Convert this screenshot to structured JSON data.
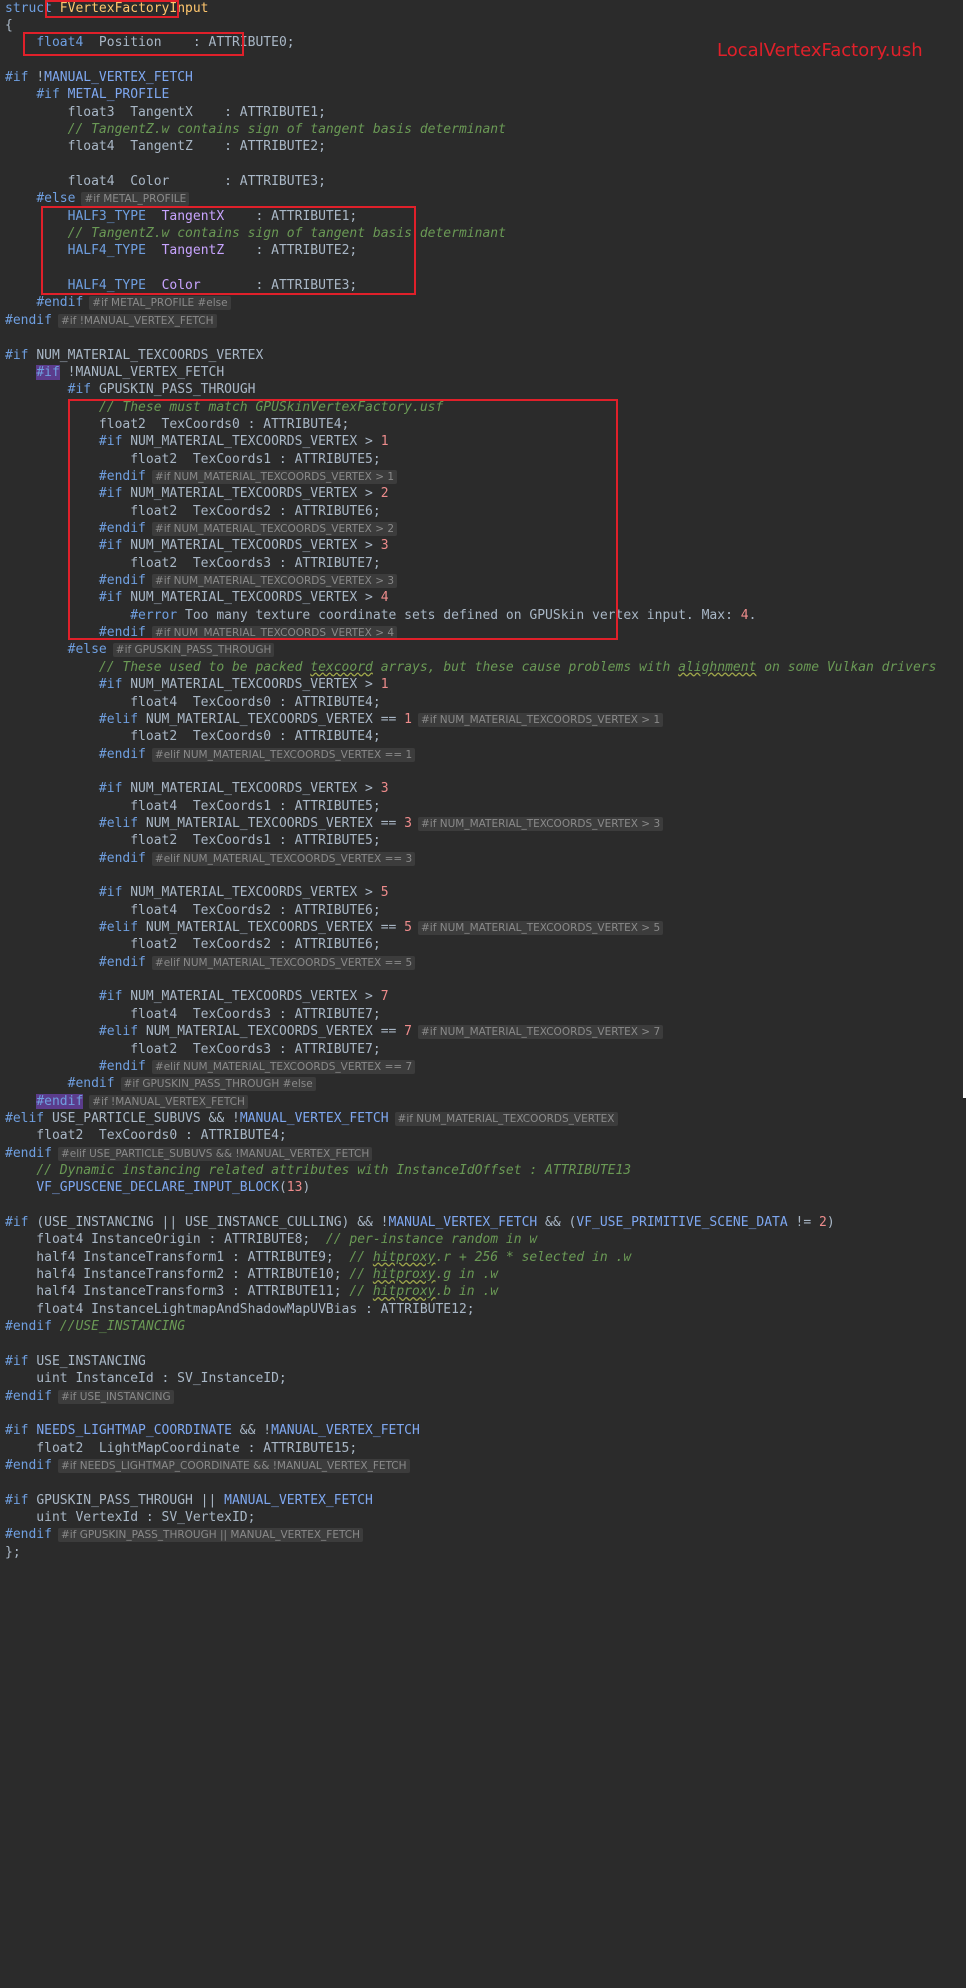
{
  "annotation": "LocalVertexFactory.ush",
  "lines": [
    [
      [
        "k",
        "struct "
      ],
      [
        "sel",
        "FVertexFactoryInput"
      ]
    ],
    [
      [
        "p",
        "{"
      ]
    ],
    [
      [
        "p",
        "    "
      ],
      [
        "k",
        "float4"
      ],
      [
        "p",
        "  Position    : ATTRIBUTE0;"
      ]
    ],
    [],
    [
      [
        "dir",
        "#if "
      ],
      [
        "p",
        "!"
      ],
      [
        "m",
        "MANUAL_VERTEX_FETCH"
      ]
    ],
    [
      [
        "p",
        "    "
      ],
      [
        "dir",
        "#if "
      ],
      [
        "m",
        "METAL_PROFILE"
      ]
    ],
    [
      [
        "p",
        "        float3  TangentX    : ATTRIBUTE1;"
      ]
    ],
    [
      [
        "p",
        "        "
      ],
      [
        "c",
        "// TangentZ.w contains sign of tangent basis determinant"
      ]
    ],
    [
      [
        "p",
        "        float4  TangentZ    : ATTRIBUTE2;"
      ]
    ],
    [],
    [
      [
        "p",
        "        float4  Color       : ATTRIBUTE3;"
      ]
    ],
    [
      [
        "p",
        "    "
      ],
      [
        "dir",
        "#else"
      ],
      [
        "h",
        "#if METAL_PROFILE"
      ]
    ],
    [
      [
        "p",
        "        "
      ],
      [
        "k",
        "HALF3_TYPE"
      ],
      [
        "p",
        "  "
      ],
      [
        "t",
        "TangentX"
      ],
      [
        "p",
        "    : ATTRIBUTE1;"
      ]
    ],
    [
      [
        "p",
        "        "
      ],
      [
        "c",
        "// TangentZ.w contains sign of tangent basis determinant"
      ]
    ],
    [
      [
        "p",
        "        "
      ],
      [
        "k",
        "HALF4_TYPE"
      ],
      [
        "p",
        "  "
      ],
      [
        "t",
        "TangentZ"
      ],
      [
        "p",
        "    : ATTRIBUTE2;"
      ]
    ],
    [],
    [
      [
        "p",
        "        "
      ],
      [
        "k",
        "HALF4_TYPE"
      ],
      [
        "p",
        "  "
      ],
      [
        "t",
        "Color"
      ],
      [
        "p",
        "       : ATTRIBUTE3;"
      ]
    ],
    [
      [
        "p",
        "    "
      ],
      [
        "dir",
        "#endif"
      ],
      [
        "h",
        "#if METAL_PROFILE #else"
      ]
    ],
    [
      [
        "dir",
        "#endif"
      ],
      [
        "h",
        "#if !MANUAL_VERTEX_FETCH"
      ]
    ],
    [],
    [
      [
        "dir",
        "#if "
      ],
      [
        "p",
        "NUM_MATERIAL_TEXCOORDS_VERTEX"
      ]
    ],
    [
      [
        "p",
        "    "
      ],
      [
        "hl",
        "#if"
      ],
      [
        "p",
        " !MANUAL_VERTEX_FETCH"
      ]
    ],
    [
      [
        "p",
        "        "
      ],
      [
        "dir",
        "#if "
      ],
      [
        "p",
        "GPUSKIN_PASS_THROUGH"
      ]
    ],
    [
      [
        "p",
        "            "
      ],
      [
        "c",
        "// These must match GPUSkinVertexFactory.usf"
      ]
    ],
    [
      [
        "p",
        "            float2  TexCoords0 : ATTRIBUTE4;"
      ]
    ],
    [
      [
        "p",
        "            "
      ],
      [
        "dir",
        "#if "
      ],
      [
        "p",
        "NUM_MATERIAL_TEXCOORDS_VERTEX > "
      ],
      [
        "n",
        "1"
      ]
    ],
    [
      [
        "p",
        "                float2  TexCoords1 : ATTRIBUTE5;"
      ]
    ],
    [
      [
        "p",
        "            "
      ],
      [
        "dir",
        "#endif"
      ],
      [
        "h",
        "#if NUM_MATERIAL_TEXCOORDS_VERTEX > 1"
      ]
    ],
    [
      [
        "p",
        "            "
      ],
      [
        "dir",
        "#if "
      ],
      [
        "p",
        "NUM_MATERIAL_TEXCOORDS_VERTEX > "
      ],
      [
        "n",
        "2"
      ]
    ],
    [
      [
        "p",
        "                float2  TexCoords2 : ATTRIBUTE6;"
      ]
    ],
    [
      [
        "p",
        "            "
      ],
      [
        "dir",
        "#endif"
      ],
      [
        "h",
        "#if NUM_MATERIAL_TEXCOORDS_VERTEX > 2"
      ]
    ],
    [
      [
        "p",
        "            "
      ],
      [
        "dir",
        "#if "
      ],
      [
        "p",
        "NUM_MATERIAL_TEXCOORDS_VERTEX > "
      ],
      [
        "n",
        "3"
      ]
    ],
    [
      [
        "p",
        "                float2  TexCoords3 : ATTRIBUTE7;"
      ]
    ],
    [
      [
        "p",
        "            "
      ],
      [
        "dir",
        "#endif"
      ],
      [
        "h",
        "#if NUM_MATERIAL_TEXCOORDS_VERTEX > 3"
      ]
    ],
    [
      [
        "p",
        "            "
      ],
      [
        "dir",
        "#if "
      ],
      [
        "p",
        "NUM_MATERIAL_TEXCOORDS_VERTEX > "
      ],
      [
        "n",
        "4"
      ]
    ],
    [
      [
        "p",
        "                "
      ],
      [
        "dir",
        "#error"
      ],
      [
        "p",
        " Too many texture coordinate sets defined on GPUSkin vertex input. Max: "
      ],
      [
        "n",
        "4"
      ],
      [
        "p",
        "."
      ]
    ],
    [
      [
        "p",
        "            "
      ],
      [
        "dir",
        "#endif"
      ],
      [
        "h",
        "#if NUM_MATERIAL_TEXCOORDS_VERTEX > 4"
      ]
    ],
    [
      [
        "p",
        "        "
      ],
      [
        "dir",
        "#else"
      ],
      [
        "h",
        "#if GPUSKIN_PASS_THROUGH"
      ]
    ],
    [
      [
        "p",
        "            "
      ],
      [
        "c",
        "// These used to be packed "
      ],
      [
        "cu",
        "texcoord"
      ],
      [
        "c",
        " arrays, but these cause problems with "
      ],
      [
        "cu",
        "alighnment"
      ],
      [
        "c",
        " on some Vulkan drivers"
      ]
    ],
    [
      [
        "p",
        "            "
      ],
      [
        "dir",
        "#if "
      ],
      [
        "p",
        "NUM_MATERIAL_TEXCOORDS_VERTEX > "
      ],
      [
        "n",
        "1"
      ]
    ],
    [
      [
        "p",
        "                float4  TexCoords0 : ATTRIBUTE4;"
      ]
    ],
    [
      [
        "p",
        "            "
      ],
      [
        "dir",
        "#elif "
      ],
      [
        "p",
        "NUM_MATERIAL_TEXCOORDS_VERTEX == "
      ],
      [
        "n",
        "1"
      ],
      [
        "h",
        "#if NUM_MATERIAL_TEXCOORDS_VERTEX > 1"
      ]
    ],
    [
      [
        "p",
        "                float2  TexCoords0 : ATTRIBUTE4;"
      ]
    ],
    [
      [
        "p",
        "            "
      ],
      [
        "dir",
        "#endif"
      ],
      [
        "h",
        "#elif NUM_MATERIAL_TEXCOORDS_VERTEX == 1"
      ]
    ],
    [],
    [
      [
        "p",
        "            "
      ],
      [
        "dir",
        "#if "
      ],
      [
        "p",
        "NUM_MATERIAL_TEXCOORDS_VERTEX > "
      ],
      [
        "n",
        "3"
      ]
    ],
    [
      [
        "p",
        "                float4  TexCoords1 : ATTRIBUTE5;"
      ]
    ],
    [
      [
        "p",
        "            "
      ],
      [
        "dir",
        "#elif "
      ],
      [
        "p",
        "NUM_MATERIAL_TEXCOORDS_VERTEX == "
      ],
      [
        "n",
        "3"
      ],
      [
        "h",
        "#if NUM_MATERIAL_TEXCOORDS_VERTEX > 3"
      ]
    ],
    [
      [
        "p",
        "                float2  TexCoords1 : ATTRIBUTE5;"
      ]
    ],
    [
      [
        "p",
        "            "
      ],
      [
        "dir",
        "#endif"
      ],
      [
        "h",
        "#elif NUM_MATERIAL_TEXCOORDS_VERTEX == 3"
      ]
    ],
    [],
    [
      [
        "p",
        "            "
      ],
      [
        "dir",
        "#if "
      ],
      [
        "p",
        "NUM_MATERIAL_TEXCOORDS_VERTEX > "
      ],
      [
        "n",
        "5"
      ]
    ],
    [
      [
        "p",
        "                float4  TexCoords2 : ATTRIBUTE6;"
      ]
    ],
    [
      [
        "p",
        "            "
      ],
      [
        "dir",
        "#elif "
      ],
      [
        "p",
        "NUM_MATERIAL_TEXCOORDS_VERTEX == "
      ],
      [
        "n",
        "5"
      ],
      [
        "h",
        "#if NUM_MATERIAL_TEXCOORDS_VERTEX > 5"
      ]
    ],
    [
      [
        "p",
        "                float2  TexCoords2 : ATTRIBUTE6;"
      ]
    ],
    [
      [
        "p",
        "            "
      ],
      [
        "dir",
        "#endif"
      ],
      [
        "h",
        "#elif NUM_MATERIAL_TEXCOORDS_VERTEX == 5"
      ]
    ],
    [],
    [
      [
        "p",
        "            "
      ],
      [
        "dir",
        "#if "
      ],
      [
        "p",
        "NUM_MATERIAL_TEXCOORDS_VERTEX > "
      ],
      [
        "n",
        "7"
      ]
    ],
    [
      [
        "p",
        "                float4  TexCoords3 : ATTRIBUTE7;"
      ]
    ],
    [
      [
        "p",
        "            "
      ],
      [
        "dir",
        "#elif "
      ],
      [
        "p",
        "NUM_MATERIAL_TEXCOORDS_VERTEX == "
      ],
      [
        "n",
        "7"
      ],
      [
        "h",
        "#if NUM_MATERIAL_TEXCOORDS_VERTEX > 7"
      ]
    ],
    [
      [
        "p",
        "                float2  TexCoords3 : ATTRIBUTE7;"
      ]
    ],
    [
      [
        "p",
        "            "
      ],
      [
        "dir",
        "#endif"
      ],
      [
        "h",
        "#elif NUM_MATERIAL_TEXCOORDS_VERTEX == 7"
      ]
    ],
    [
      [
        "p",
        "        "
      ],
      [
        "dir",
        "#endif"
      ],
      [
        "h",
        "#if GPUSKIN_PASS_THROUGH #else"
      ]
    ],
    [
      [
        "p",
        "    "
      ],
      [
        "hl",
        "#endif"
      ],
      [
        "h",
        "#if !MANUAL_VERTEX_FETCH"
      ]
    ],
    [
      [
        "dir",
        "#elif "
      ],
      [
        "p",
        "USE_PARTICLE_SUBUVS && !"
      ],
      [
        "m",
        "MANUAL_VERTEX_FETCH"
      ],
      [
        "h",
        "#if NUM_MATERIAL_TEXCOORDS_VERTEX"
      ]
    ],
    [
      [
        "p",
        "    float2  TexCoords0 : ATTRIBUTE4;"
      ]
    ],
    [
      [
        "dir",
        "#endif"
      ],
      [
        "h",
        "#elif USE_PARTICLE_SUBUVS && !MANUAL_VERTEX_FETCH"
      ]
    ],
    [
      [
        "p",
        "    "
      ],
      [
        "c",
        "// Dynamic instancing related attributes with InstanceIdOffset : ATTRIBUTE13"
      ]
    ],
    [
      [
        "p",
        "    "
      ],
      [
        "m",
        "VF_GPUSCENE_DECLARE_INPUT_BLOCK"
      ],
      [
        "p",
        "("
      ],
      [
        "n",
        "13"
      ],
      [
        "p",
        ")"
      ]
    ],
    [],
    [
      [
        "dir",
        "#if "
      ],
      [
        "p",
        "(USE_INSTANCING || USE_INSTANCE_CULLING) && !"
      ],
      [
        "m",
        "MANUAL_VERTEX_FETCH"
      ],
      [
        "p",
        " && ("
      ],
      [
        "m",
        "VF_USE_PRIMITIVE_SCENE_DATA"
      ],
      [
        "p",
        " != "
      ],
      [
        "n",
        "2"
      ],
      [
        "p",
        ")"
      ]
    ],
    [
      [
        "p",
        "    float4 InstanceOrigin : ATTRIBUTE8;  "
      ],
      [
        "c",
        "// per-instance random in w"
      ]
    ],
    [
      [
        "p",
        "    half4 InstanceTransform1 : ATTRIBUTE9;  "
      ],
      [
        "c",
        "// "
      ],
      [
        "cu",
        "hitproxy"
      ],
      [
        "c",
        ".r + 256 * selected in .w"
      ]
    ],
    [
      [
        "p",
        "    half4 InstanceTransform2 : ATTRIBUTE10; "
      ],
      [
        "c",
        "// "
      ],
      [
        "cu",
        "hitproxy"
      ],
      [
        "c",
        ".g in .w"
      ]
    ],
    [
      [
        "p",
        "    half4 InstanceTransform3 : ATTRIBUTE11; "
      ],
      [
        "c",
        "// "
      ],
      [
        "cu",
        "hitproxy"
      ],
      [
        "c",
        ".b in .w"
      ]
    ],
    [
      [
        "p",
        "    float4 InstanceLightmapAndShadowMapUVBias : ATTRIBUTE12;"
      ]
    ],
    [
      [
        "dir",
        "#endif "
      ],
      [
        "c2",
        "//USE_INSTANCING"
      ]
    ],
    [],
    [
      [
        "dir",
        "#if "
      ],
      [
        "p",
        "USE_INSTANCING"
      ]
    ],
    [
      [
        "p",
        "    uint InstanceId : SV_InstanceID;"
      ]
    ],
    [
      [
        "dir",
        "#endif"
      ],
      [
        "h",
        "#if USE_INSTANCING"
      ]
    ],
    [],
    [
      [
        "dir",
        "#if "
      ],
      [
        "m",
        "NEEDS_LIGHTMAP_COORDINATE"
      ],
      [
        "p",
        " && !"
      ],
      [
        "m",
        "MANUAL_VERTEX_FETCH"
      ]
    ],
    [
      [
        "p",
        "    float2  LightMapCoordinate : ATTRIBUTE15;"
      ]
    ],
    [
      [
        "dir",
        "#endif"
      ],
      [
        "h",
        "#if NEEDS_LIGHTMAP_COORDINATE && !MANUAL_VERTEX_FETCH"
      ]
    ],
    [],
    [
      [
        "dir",
        "#if "
      ],
      [
        "p",
        "GPUSKIN_PASS_THROUGH || "
      ],
      [
        "m",
        "MANUAL_VERTEX_FETCH"
      ]
    ],
    [
      [
        "p",
        "    uint VertexId : SV_VertexID;"
      ]
    ],
    [
      [
        "dir",
        "#endif"
      ],
      [
        "h",
        "#if GPUSKIN_PASS_THROUGH || MANUAL_VERTEX_FETCH"
      ]
    ],
    [
      [
        "p",
        "};"
      ]
    ]
  ]
}
